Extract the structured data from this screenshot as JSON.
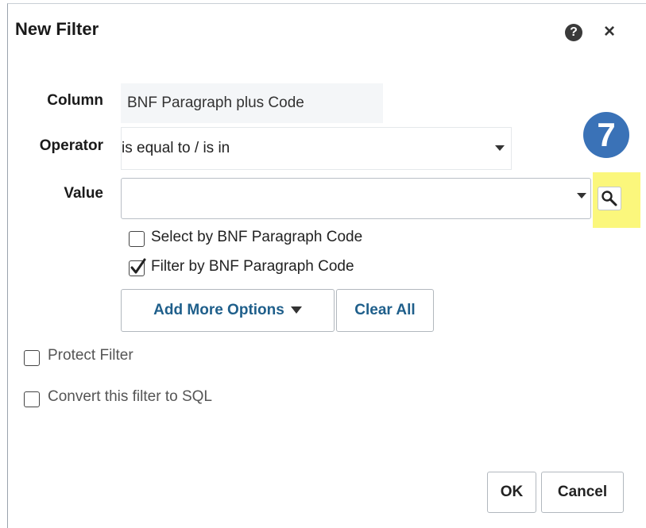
{
  "dialog": {
    "title": "New Filter",
    "help_glyph": "?",
    "close_glyph": "×"
  },
  "form": {
    "column_label": "Column",
    "column_value": "BNF Paragraph plus Code",
    "operator_label": "Operator",
    "operator_value": "is equal to / is in",
    "value_label": "Value",
    "value_text": ""
  },
  "badge": {
    "number": "7",
    "color": "#3a72b7"
  },
  "highlight_color": "#fbf77c",
  "checkboxes": {
    "select_by_code": {
      "label": "Select by BNF Paragraph Code",
      "checked": false
    },
    "filter_by_code": {
      "label": "Filter by BNF Paragraph Code",
      "checked": true
    },
    "protect_filter": {
      "label": "Protect Filter",
      "checked": false
    },
    "convert_sql": {
      "label": "Convert this filter to SQL",
      "checked": false
    }
  },
  "buttons": {
    "add_more_options": "Add More Options",
    "clear_all": "Clear All",
    "ok": "OK",
    "cancel": "Cancel"
  }
}
